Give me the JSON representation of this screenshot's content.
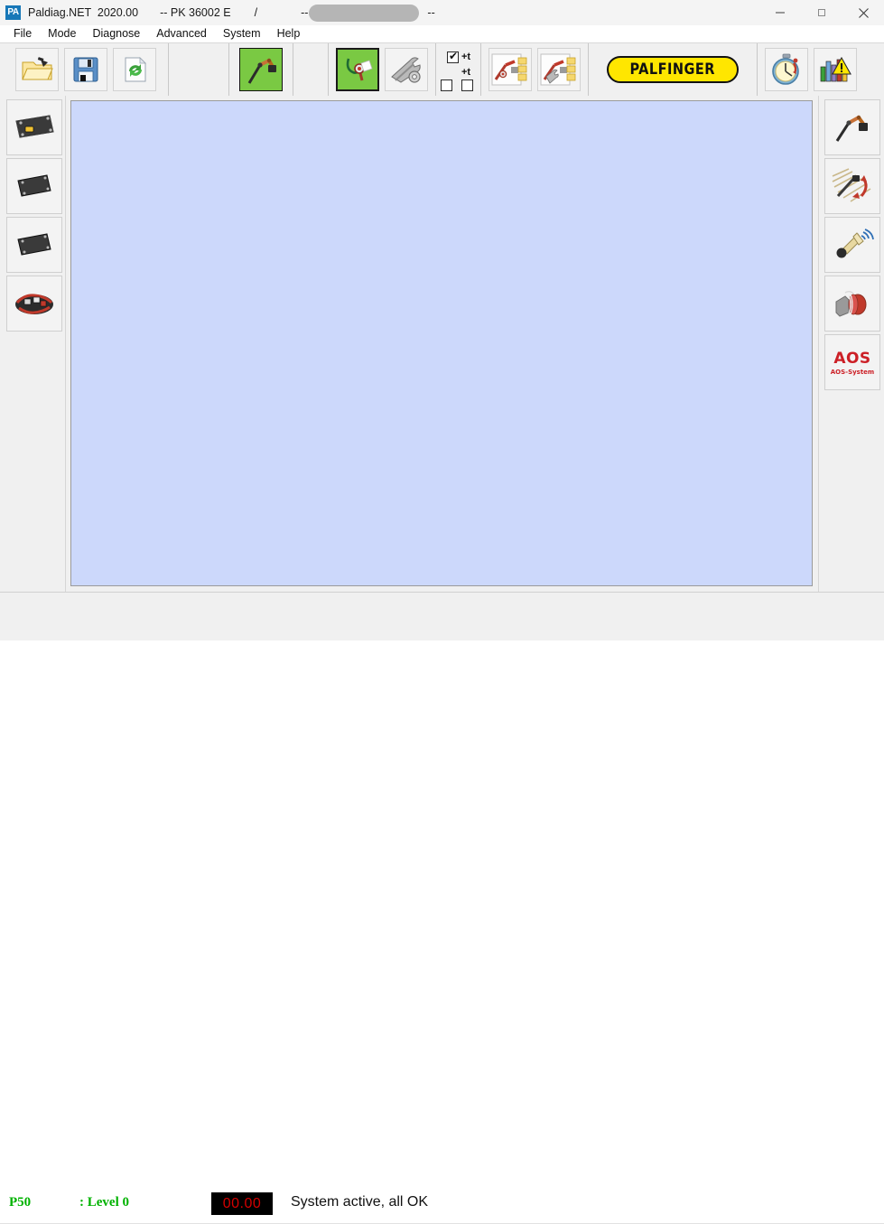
{
  "window": {
    "app_icon_label": "PA",
    "title": "Paldiag.NET  2020.00",
    "machine": "-- PK 36002 E",
    "separator": "/",
    "dashes_left": "--",
    "dashes_right": "--",
    "redacted": true,
    "controls": {
      "minimize": "minimize-button",
      "maximize": "maximize-button",
      "close": "close-button"
    }
  },
  "menubar": {
    "items": [
      {
        "label": "File"
      },
      {
        "label": "Mode"
      },
      {
        "label": "Diagnose"
      },
      {
        "label": "Advanced"
      },
      {
        "label": "System"
      },
      {
        "label": "Help"
      }
    ]
  },
  "toolbar": {
    "groups": [
      {
        "name": "file-group",
        "buttons": [
          {
            "name": "open-file-button",
            "icon": "open-folder-icon",
            "selected": false
          },
          {
            "name": "save-file-button",
            "icon": "floppy-save-icon",
            "selected": false
          },
          {
            "name": "refresh-button",
            "icon": "refresh-arrows-icon",
            "selected": false
          }
        ]
      },
      {
        "name": "crane-group",
        "buttons": [
          {
            "name": "crane-view-button",
            "icon": "crane-green-icon",
            "selected": false
          }
        ]
      },
      {
        "name": "diagnose-group",
        "buttons": [
          {
            "name": "diagnose-button",
            "icon": "stethoscope-icon",
            "selected": true
          },
          {
            "name": "service-tools-button",
            "icon": "wrench-tools-icon",
            "selected": false
          }
        ]
      },
      {
        "name": "parameter-group",
        "buttons": [
          {
            "name": "read-parameters-button",
            "icon": "crane-diagnose-folder-icon",
            "selected": false
          },
          {
            "name": "write-parameters-button",
            "icon": "crane-tools-folder-icon",
            "selected": false
          }
        ]
      },
      {
        "name": "brand-group",
        "buttons": [
          {
            "name": "palfinger-logo-button",
            "icon": "palfinger-logo",
            "selected": false
          }
        ]
      },
      {
        "name": "monitor-group",
        "buttons": [
          {
            "name": "operating-hours-button",
            "icon": "stopwatch-icon",
            "selected": false
          },
          {
            "name": "statistics-warning-button",
            "icon": "bar-chart-warning-icon",
            "selected": false
          }
        ]
      }
    ],
    "checkboxes": [
      {
        "name": "trace-time-1-checkbox",
        "label": "+t",
        "checked": true
      },
      {
        "name": "trace-time-2-checkbox",
        "label": "+t",
        "checked": false
      },
      {
        "name": "trace-time-3-checkbox",
        "label": "",
        "checked": false
      }
    ],
    "palfinger_text": "PALFINGER"
  },
  "sidebar_left": {
    "items": [
      {
        "name": "ecu-module-1-button",
        "icon": "ecu-module-labeled-icon"
      },
      {
        "name": "ecu-module-2-button",
        "icon": "ecu-module-icon"
      },
      {
        "name": "ecu-module-3-button",
        "icon": "ecu-module-icon"
      },
      {
        "name": "cable-harness-button",
        "icon": "cable-harness-icon"
      }
    ]
  },
  "sidebar_right": {
    "items": [
      {
        "name": "crane-function-button",
        "icon": "crane-icon"
      },
      {
        "name": "rotation-function-button",
        "icon": "rotation-arrows-icon"
      },
      {
        "name": "horn-function-button",
        "icon": "horn-icon"
      },
      {
        "name": "emergency-stop-button",
        "icon": "emergency-stop-icon"
      },
      {
        "name": "aos-system-button",
        "icon": "aos-logo",
        "title": "AOS",
        "subtitle": "AOS-System"
      }
    ]
  },
  "main": {
    "canvas_empty": true
  },
  "statusbar": {
    "position_label": "P50",
    "level_label": ": Level 0",
    "value_display": "00.00",
    "message": "System active, all OK"
  },
  "colors": {
    "canvas": "#ccd8fb",
    "chrome": "#f0f0f0",
    "status_green": "#00b200",
    "lcd_red": "#d40000",
    "palfinger_yellow": "#ffe600",
    "aos_red": "#cc1f26",
    "accent_blue": "#1878b8"
  }
}
